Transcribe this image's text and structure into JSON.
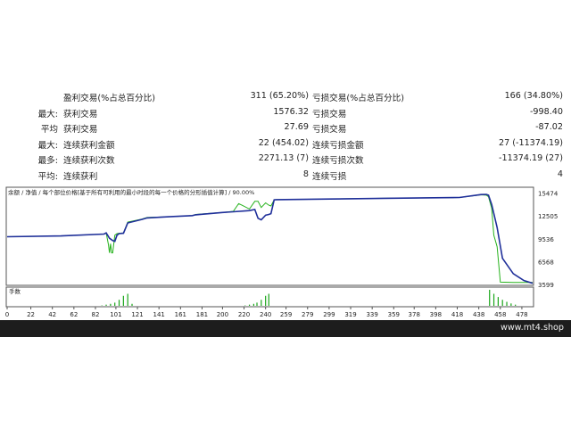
{
  "stats": {
    "rows": [
      {
        "label1": "",
        "label2": "盈利交易(%占总百分比)",
        "value1": "311 (65.20%)",
        "label3": "亏损交易(%占总百分比)",
        "value2": "166 (34.80%)"
      },
      {
        "label1": "最大:",
        "label2": "获利交易",
        "value1": "1576.32",
        "label3": "亏损交易",
        "value2": "-998.40"
      },
      {
        "label1": "平均",
        "label2": "获利交易",
        "value1": "27.69",
        "label3": "亏损交易",
        "value2": "-87.02"
      },
      {
        "label1": "最大:",
        "label2": "连续获利金额",
        "value1": "22 (454.02)",
        "label3": "连续亏损金额",
        "value2": "27 (-11374.19)"
      },
      {
        "label1": "最多:",
        "label2": "连续获利次数",
        "value1": "2271.13 (7)",
        "label3": "连续亏损次数",
        "value2": "-11374.19 (27)"
      },
      {
        "label1": "平均:",
        "label2": "连续获利",
        "value1": "8",
        "label3": "连续亏损",
        "value2": "4"
      }
    ]
  },
  "chart_header": {
    "balance_label": "余额",
    "equity_label": "净值",
    "lot_label": "每个部位价格",
    "description": "[基于所有可利用的最小时段的每一个价格的分形插值计算]",
    "quality": "90.00%"
  },
  "volume_label": "手数",
  "colors": {
    "balance": "#1f2f9a",
    "equity": "#26b21c",
    "volume": "#1aa61a",
    "border": "#555555"
  },
  "chart_data": {
    "type": "line",
    "title": "",
    "xlabel": "",
    "ylabel": "",
    "xlim": [
      0,
      488
    ],
    "ylim": [
      3599,
      16000
    ],
    "x_ticks": [
      0,
      22,
      42,
      62,
      82,
      101,
      121,
      141,
      161,
      181,
      200,
      220,
      240,
      259,
      279,
      299,
      319,
      339,
      359,
      378,
      398,
      418,
      438,
      458,
      478
    ],
    "y_ticks": [
      15474,
      12505,
      9536,
      6568,
      3599
    ],
    "series": [
      {
        "name": "余额",
        "x": [
          0,
          50,
          90,
          92,
          95,
          98,
          100,
          102,
          104,
          108,
          112,
          125,
          130,
          150,
          172,
          175,
          200,
          210,
          225,
          230,
          233,
          236,
          240,
          243,
          245,
          248,
          250,
          300,
          350,
          420,
          440,
          445,
          447,
          450,
          455,
          460,
          470,
          480,
          488
        ],
        "values": [
          9800,
          9900,
          10150,
          10300,
          9600,
          9300,
          9200,
          10000,
          10200,
          10250,
          11600,
          12050,
          12250,
          12400,
          12550,
          12650,
          12950,
          13050,
          13200,
          13350,
          12200,
          12000,
          12600,
          12700,
          12800,
          14600,
          14620,
          14700,
          14800,
          14900,
          15280,
          15300,
          15200,
          14000,
          11000,
          7000,
          5000,
          4100,
          3750
        ]
      },
      {
        "name": "净值",
        "x": [
          0,
          50,
          90,
          92,
          94,
          95,
          96,
          97,
          98,
          100,
          102,
          104,
          108,
          112,
          125,
          130,
          150,
          172,
          175,
          200,
          210,
          215,
          218,
          225,
          230,
          233,
          236,
          240,
          243,
          245,
          248,
          250,
          300,
          350,
          420,
          440,
          445,
          447,
          450,
          452,
          455,
          458,
          470,
          480,
          488
        ],
        "values": [
          9800,
          9900,
          10150,
          10300,
          8800,
          7700,
          8900,
          7700,
          7700,
          10000,
          10200,
          10250,
          10300,
          11700,
          12100,
          12300,
          12400,
          12550,
          12700,
          12950,
          13100,
          14100,
          13900,
          13400,
          14400,
          14400,
          13600,
          14200,
          13900,
          13800,
          14600,
          14620,
          14700,
          14800,
          14900,
          15250,
          15200,
          15000,
          13500,
          10000,
          8500,
          3900,
          3850,
          3850,
          3850
        ]
      }
    ],
    "volume": {
      "x": [
        88,
        92,
        96,
        100,
        104,
        108,
        112,
        116,
        221,
        225,
        229,
        232,
        236,
        240,
        243,
        448,
        452,
        456,
        460,
        464,
        468,
        472
      ],
      "values": [
        1,
        3,
        5,
        8,
        15,
        25,
        30,
        5,
        1,
        3,
        5,
        8,
        15,
        25,
        30,
        40,
        30,
        22,
        15,
        10,
        6,
        3
      ]
    }
  },
  "footer": {
    "text": "www.mt4.shop"
  }
}
